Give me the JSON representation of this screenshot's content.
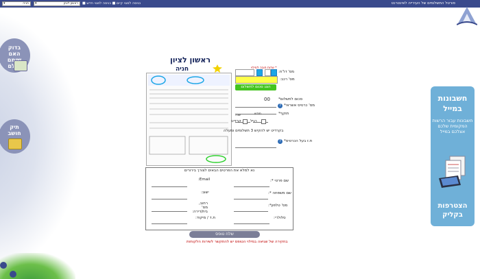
{
  "topbar": {
    "title": "פורטל התשלומים של העירייה לאינטרנט",
    "link_existing": "כניסה למנוי קיים",
    "link_new": "כניסה למנוי חדש",
    "city_select": "ראשון לציון",
    "service_select": "חניה"
  },
  "side": {
    "check_paid": "בדוק האם שומם שולם",
    "balance": "תיק חושב"
  },
  "header": {
    "city": "ראשון לציון",
    "service": "חניה"
  },
  "form_top": {
    "required_note": "* שדות חובה למילוי",
    "label_report_no": "מס' דו\"ח:",
    "label_car_no": "מס' רכב:",
    "calc_button": "הצג סכום לתשלום",
    "label_amount": "סכום לתשלום*",
    "amount_value": "00",
    "label_card": "מס' כרטיס אשראי*",
    "label_expiry": "תוקף*",
    "month_hint": "חודש",
    "year_hint": "שנה",
    "label_regular": "רגיל",
    "label_credit": "קרדיט",
    "payments_question": "בקרדיט יש להקיש 3 תשלומים ומעלה",
    "label_id": "ת.ז בעל הכרטיס*"
  },
  "contact": {
    "header": "נא למלא את הפרטים הבאים לצורך בירורים",
    "first_name": "שם פרטי *:",
    "last_name": "שם משפחה *:",
    "phone": "מס' טלפון*:",
    "mobile": "סלולרי:",
    "email": "Email:",
    "city": "ישוב:",
    "street": "רחוב, מס' בית/דירה:",
    "zip": "ת.ד / מיקוד:"
  },
  "send_button": "שלח טופס",
  "bottom_note": "בחקירה של שגיאה במילוי הטופס יש להתקשר לשירות הלקוחות",
  "banner": {
    "line1": "חשבונות במייל",
    "line2": "חשבונות עבור הרשות המקומית שלכם אצלכם במייל",
    "line3": "הצטרפות בקליק"
  },
  "colors": {
    "topbar": "#3a4a8c",
    "calc_button": "#44c41f",
    "banner": "#6fb0d8",
    "send_button": "#7b7e97"
  }
}
